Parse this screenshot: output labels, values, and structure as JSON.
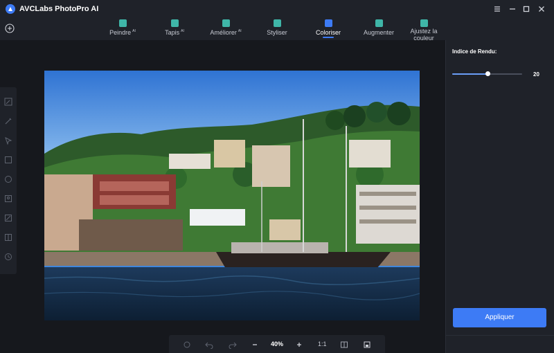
{
  "app": {
    "title": "AVCLabs PhotoPro AI"
  },
  "toolbar": {
    "tools": [
      {
        "label": "Peindre",
        "badge": "AI",
        "icon": "paint-bucket-icon",
        "color": "#3fb6a8"
      },
      {
        "label": "Tapis",
        "badge": "AI",
        "icon": "mat-icon",
        "color": "#3fb6a8"
      },
      {
        "label": "Améliorer",
        "badge": "AI",
        "icon": "enhance-icon",
        "color": "#3fb6a8"
      },
      {
        "label": "Styliser",
        "badge": "",
        "icon": "stylize-icon",
        "color": "#3fb6a8"
      },
      {
        "label": "Coloriser",
        "badge": "",
        "icon": "colorize-icon",
        "color": "#3d7bf5"
      },
      {
        "label": "Augmenter",
        "badge": "",
        "icon": "upscale-icon",
        "color": "#3fb6a8"
      },
      {
        "label": "Ajustez la couleur",
        "badge": "",
        "icon": "adjust-color-icon",
        "color": "#3fb6a8"
      }
    ],
    "active_tool": "Coloriser"
  },
  "canvas": {
    "zoom": "40%",
    "ratio": "1:1"
  },
  "panel": {
    "label": "Indice de Rendu:",
    "slider_value": "20",
    "slider_fraction": 0.5,
    "apply_label": "Appliquer"
  },
  "colors": {
    "accent": "#3d7bf5",
    "background": "#16181d",
    "panel": "#1f2229"
  }
}
